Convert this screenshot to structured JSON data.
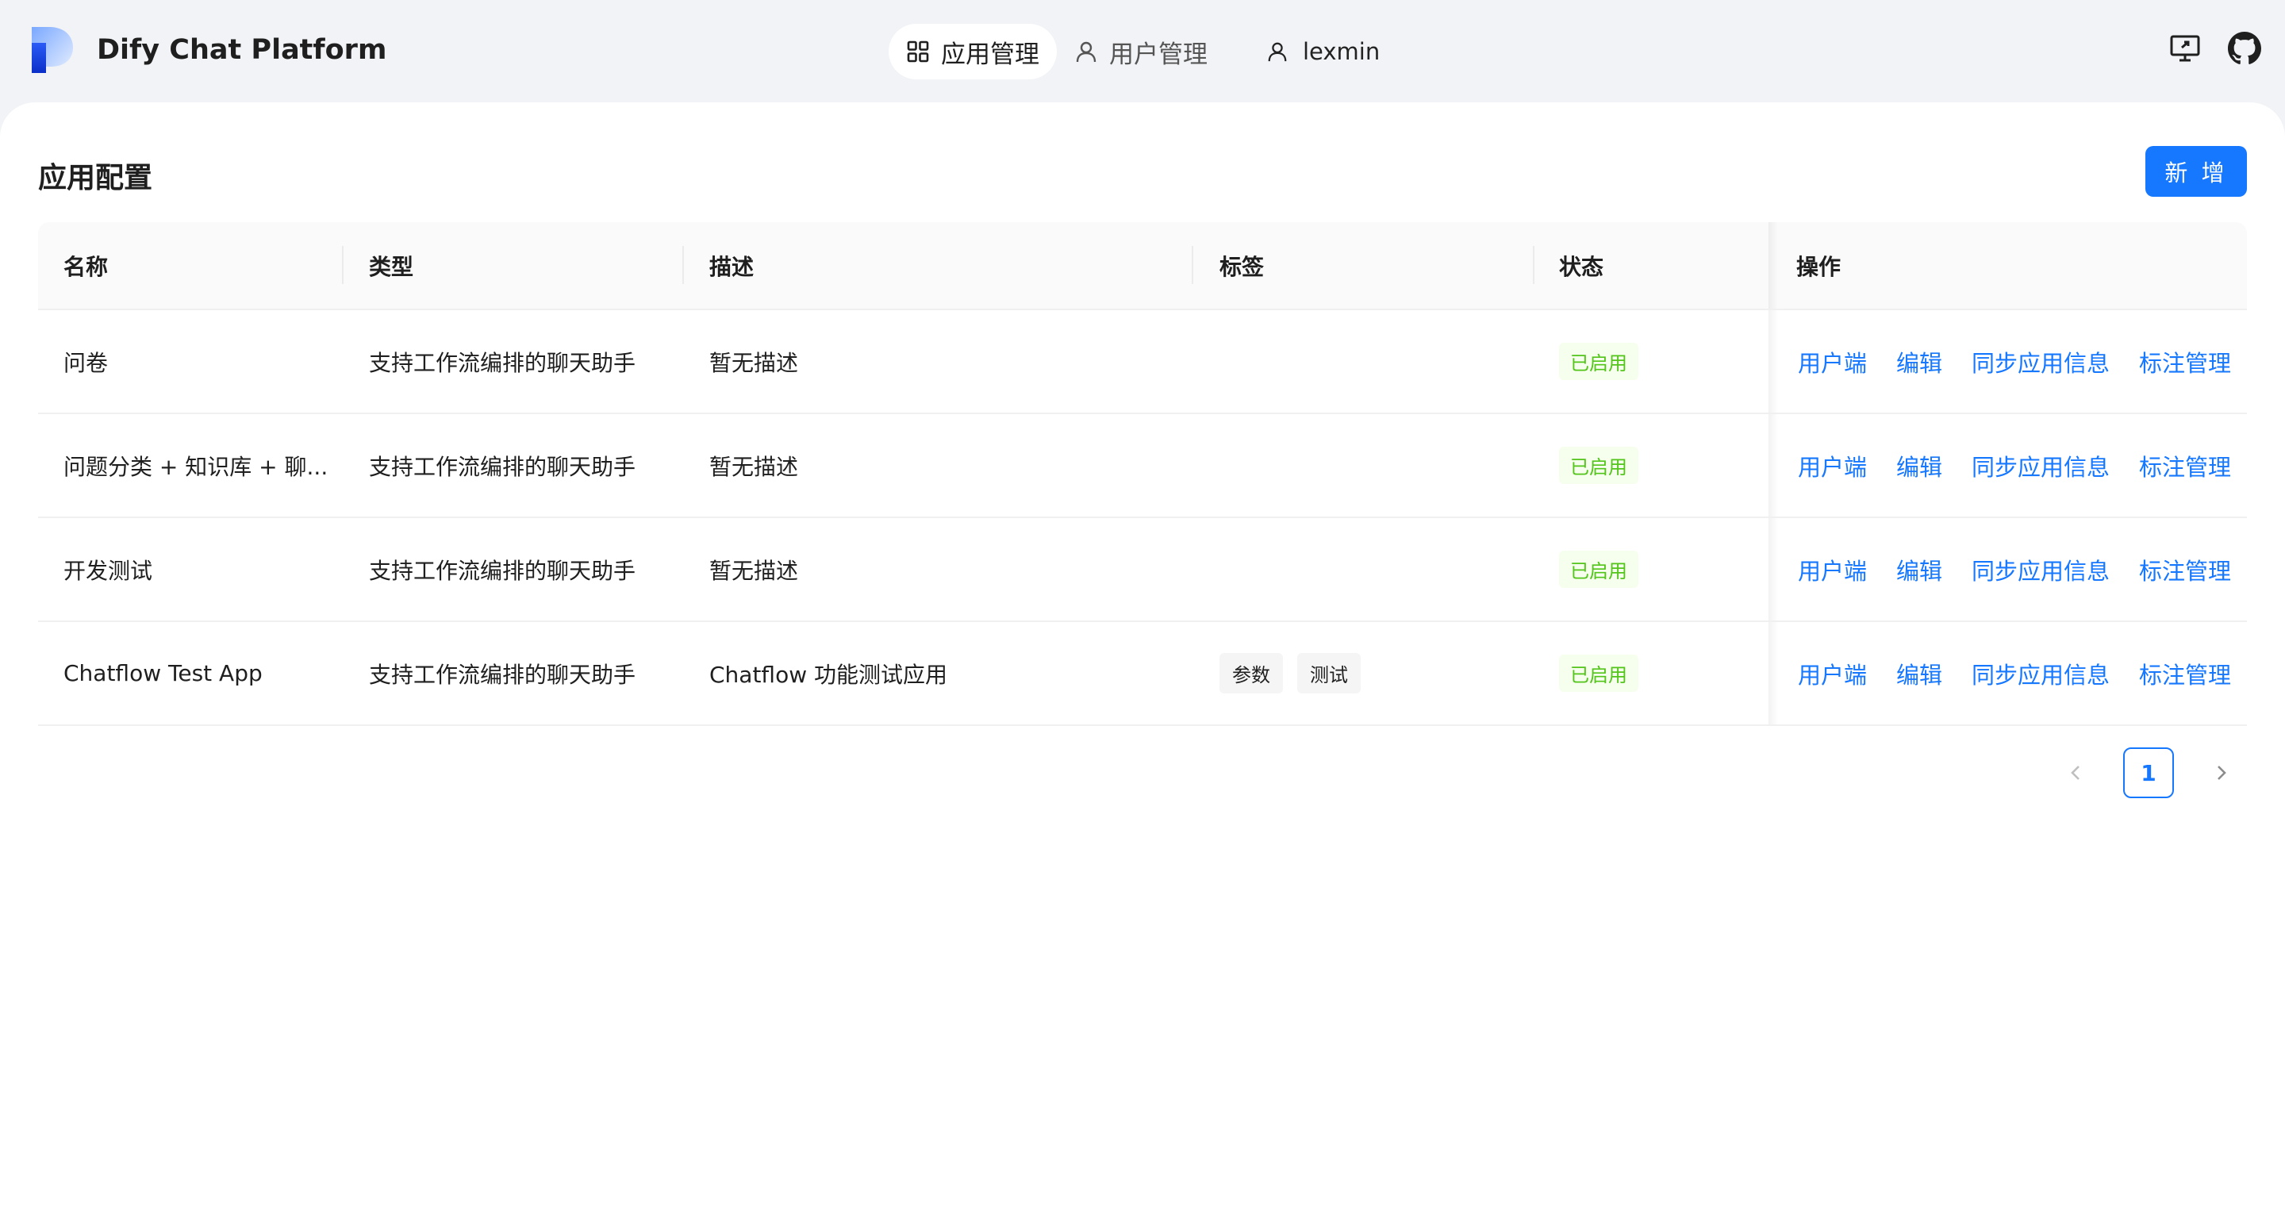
{
  "app": {
    "title": "Dify Chat Platform"
  },
  "nav": {
    "items": [
      {
        "label": "应用管理",
        "icon": "apps-grid-icon",
        "active": true
      },
      {
        "label": "用户管理",
        "icon": "user-icon",
        "active": false
      }
    ],
    "user": {
      "name": "lexmin",
      "icon": "user-icon"
    }
  },
  "header_icons": [
    "monitor-icon",
    "github-icon"
  ],
  "page": {
    "title": "应用配置",
    "add_label": "新 增"
  },
  "table": {
    "columns": [
      "名称",
      "类型",
      "描述",
      "标签",
      "状态",
      "操作"
    ],
    "rows": [
      {
        "name": "问卷",
        "type": "支持工作流编排的聊天助手",
        "description": "暂无描述",
        "tags": [],
        "status": "已启用",
        "actions": [
          "用户端",
          "编辑",
          "同步应用信息",
          "标注管理"
        ]
      },
      {
        "name": "问题分类 + 知识库 + 聊...",
        "type": "支持工作流编排的聊天助手",
        "description": "暂无描述",
        "tags": [],
        "status": "已启用",
        "actions": [
          "用户端",
          "编辑",
          "同步应用信息",
          "标注管理"
        ]
      },
      {
        "name": "开发测试",
        "type": "支持工作流编排的聊天助手",
        "description": "暂无描述",
        "tags": [],
        "status": "已启用",
        "actions": [
          "用户端",
          "编辑",
          "同步应用信息",
          "标注管理"
        ]
      },
      {
        "name": "Chatflow Test App",
        "type": "支持工作流编排的聊天助手",
        "description": "Chatflow 功能测试应用",
        "tags": [
          "参数",
          "测试"
        ],
        "status": "已启用",
        "actions": [
          "用户端",
          "编辑",
          "同步应用信息",
          "标注管理"
        ]
      }
    ]
  },
  "pagination": {
    "current": "1"
  },
  "colors": {
    "primary": "#1677ff",
    "status_bg": "#f6ffed",
    "status_text": "#52c41a",
    "page_bg": "#f2f3f6"
  }
}
